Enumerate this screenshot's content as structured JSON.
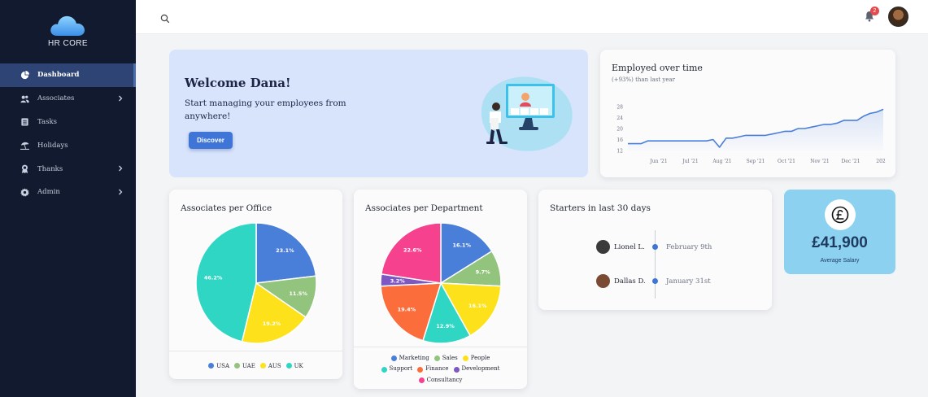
{
  "app": {
    "name": "HR CORE"
  },
  "sidebar": {
    "items": [
      {
        "label": "Dashboard",
        "icon": "dashboard-icon",
        "active": true,
        "chevron": false
      },
      {
        "label": "Associates",
        "icon": "people-icon",
        "active": false,
        "chevron": true
      },
      {
        "label": "Tasks",
        "icon": "clipboard-icon",
        "active": false,
        "chevron": false
      },
      {
        "label": "Holidays",
        "icon": "umbrella-beach-icon",
        "active": false,
        "chevron": false
      },
      {
        "label": "Thanks",
        "icon": "award-icon",
        "active": false,
        "chevron": true
      },
      {
        "label": "Admin",
        "icon": "gear-icon",
        "active": false,
        "chevron": true
      }
    ]
  },
  "topbar": {
    "notification_count": "2"
  },
  "welcome": {
    "title": "Welcome Dana!",
    "text": "Start managing your employees from anywhere!",
    "button": "Discover"
  },
  "employed": {
    "title": "Employed over time",
    "subtitle": "(+93%) than last year"
  },
  "office": {
    "title": "Associates per Office",
    "legend": [
      "USA",
      "UAE",
      "AUS",
      "UK"
    ]
  },
  "dept": {
    "title": "Associates per Department",
    "legend": [
      "Marketing",
      "Sales",
      "People",
      "Support",
      "Finance",
      "Development",
      "Consultancy"
    ]
  },
  "starters": {
    "title": "Starters in last 30 days",
    "items": [
      {
        "name": "Lionel L.",
        "date": "February 9th",
        "avatar_color": "#3a3a3a"
      },
      {
        "name": "Dallas D.",
        "date": "January 31st",
        "avatar_color": "#7a4a33"
      }
    ]
  },
  "salary": {
    "value": "£41,900",
    "label": "Average Salary"
  },
  "colors": {
    "sidebar": "#111a2e",
    "accent": "#3e75d6",
    "welcome_bg": "#d8e4fc",
    "salary_bg": "#8dd1f1"
  },
  "chart_data": [
    {
      "type": "line",
      "title": "Employed over time",
      "subtitle": "(+93%) than last year",
      "x_ticks": [
        "Jun '21",
        "Jul '21",
        "Aug '21",
        "Sep '21",
        "Oct '21",
        "Nov '21",
        "Dec '21",
        "202"
      ],
      "y_ticks": [
        12,
        16,
        20,
        24,
        28
      ],
      "ylim": [
        12,
        28
      ],
      "series": [
        {
          "values": [
            14.5,
            14.5,
            14.5,
            15.5,
            15.5,
            15.5,
            15.5,
            15.5,
            15.5,
            15.5,
            15.5,
            15.5,
            15.5,
            16.0,
            13.2,
            16.5,
            16.5,
            17.0,
            17.5,
            17.5,
            17.5,
            17.5,
            18.0,
            18.5,
            19.0,
            19.0,
            20.0,
            20.0,
            20.5,
            21.0,
            21.5,
            21.5,
            22.0,
            23.0,
            23.0,
            23.0,
            24.5,
            25.5,
            26.0,
            27.0
          ]
        }
      ],
      "grid": false
    },
    {
      "type": "pie",
      "title": "Associates per Office",
      "labels": [
        "USA",
        "UAE",
        "AUS",
        "UK"
      ],
      "values": [
        23.1,
        11.5,
        19.2,
        46.2
      ],
      "display": [
        "23.1%",
        "11.5%",
        "19.2%",
        "46.2%"
      ],
      "colors": [
        "#4a7fd9",
        "#93c47d",
        "#fde21b",
        "#2fd6c3"
      ]
    },
    {
      "type": "pie",
      "title": "Associates per Department",
      "labels": [
        "Marketing",
        "Sales",
        "People",
        "Support",
        "Finance",
        "Development",
        "Consultancy"
      ],
      "values": [
        16.1,
        9.7,
        16.1,
        12.9,
        19.4,
        3.2,
        22.6
      ],
      "display": [
        "16.1%",
        "9.7%",
        "16.1%",
        "12.9%",
        "19.4%",
        "3.2%",
        "22.6%"
      ],
      "colors": [
        "#4a7fd9",
        "#93c47d",
        "#fde21b",
        "#2fd6c3",
        "#fb6d3b",
        "#7e57c2",
        "#f6428e"
      ]
    }
  ]
}
